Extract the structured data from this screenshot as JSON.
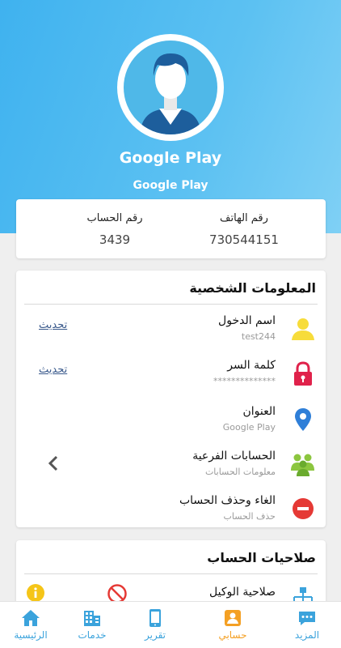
{
  "profile": {
    "name": "Google Play",
    "subtitle": "Google Play"
  },
  "stats": {
    "phone_label": "رقم الهاتف",
    "phone_value": "730544151",
    "account_label": "رقم الحساب",
    "account_value": "3439"
  },
  "personal": {
    "title": "المعلومات الشخصية",
    "rows": [
      {
        "title": "اسم الدخول",
        "sub": "test244",
        "action": "تحديث",
        "icon": "user-icon"
      },
      {
        "title": "كلمة السر",
        "sub": "**************",
        "action": "تحديث",
        "icon": "lock-icon"
      },
      {
        "title": "العنوان",
        "sub": "Google Play",
        "icon": "location-pin-icon"
      },
      {
        "title": "الحسابات الفرعية",
        "sub": "معلومات الحسابات",
        "icon": "users-group-icon"
      },
      {
        "title": "الغاء وحذف الحساب",
        "sub": "حذف الحساب",
        "icon": "minus-circle-icon"
      }
    ]
  },
  "permissions": {
    "title": "صلاحيات الحساب",
    "rows": [
      {
        "title": "صلاحية الوكيل",
        "icon": "network-icon"
      }
    ]
  },
  "nav": {
    "items": [
      {
        "label": "المزيد",
        "icon": "more-chat-icon"
      },
      {
        "label": "حسابي",
        "icon": "account-icon",
        "active": true
      },
      {
        "label": "تقرير",
        "icon": "report-phone-icon"
      },
      {
        "label": "خدمات",
        "icon": "building-icon"
      },
      {
        "label": "الرئيسية",
        "icon": "home-icon"
      }
    ]
  },
  "colors": {
    "header_blue": "#3fb2ef",
    "nav_blue": "#3ba3dc",
    "active_orange": "#f4a024",
    "link_blue": "#3a5a8c"
  }
}
